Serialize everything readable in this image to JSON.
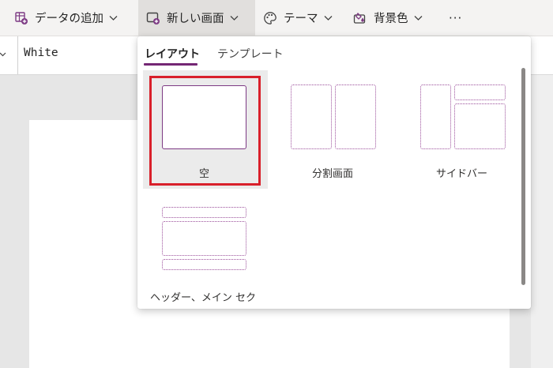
{
  "toolbar": {
    "add_data": "データの追加",
    "new_screen": "新しい画面",
    "theme": "テーマ",
    "background": "背景色",
    "more": "···"
  },
  "formula_bar": {
    "value": "White"
  },
  "new_screen_panel": {
    "tabs": [
      {
        "label": "レイアウト",
        "selected": true
      },
      {
        "label": "テンプレート",
        "selected": false
      }
    ],
    "layouts": [
      {
        "label": "空",
        "selected": true
      },
      {
        "label": "分割画面",
        "selected": false
      },
      {
        "label": "サイドバー",
        "selected": false
      },
      {
        "label": "ヘッダー、メイン セク",
        "selected": false
      }
    ]
  },
  "colors": {
    "accent": "#742774",
    "selection_outline": "#d9202b"
  },
  "icons": [
    "table-add-icon",
    "new-screen-icon",
    "palette-icon",
    "background-color-icon",
    "chevron-down-icon",
    "more-icon"
  ]
}
